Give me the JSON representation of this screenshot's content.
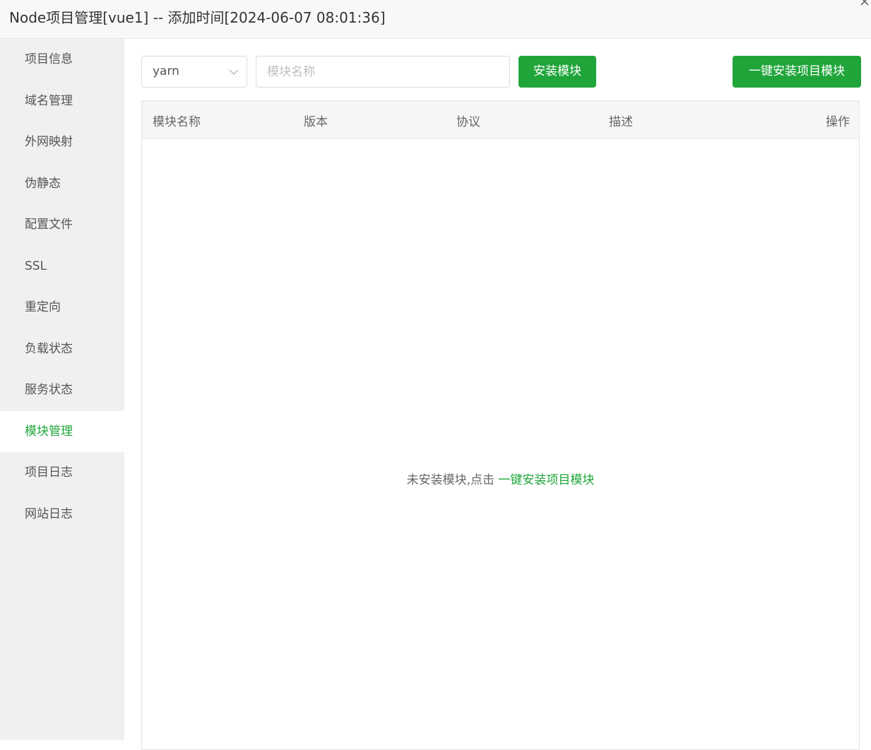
{
  "header": {
    "title": "Node项目管理[vue1] -- 添加时间[2024-06-07 08:01:36]"
  },
  "sidebar": {
    "items": [
      {
        "label": "项目信息"
      },
      {
        "label": "域名管理"
      },
      {
        "label": "外网映射"
      },
      {
        "label": "伪静态"
      },
      {
        "label": "配置文件"
      },
      {
        "label": "SSL"
      },
      {
        "label": "重定向"
      },
      {
        "label": "负载状态"
      },
      {
        "label": "服务状态"
      },
      {
        "label": "模块管理"
      },
      {
        "label": "项目日志"
      },
      {
        "label": "网站日志"
      }
    ],
    "active_index": 9
  },
  "toolbar": {
    "package_manager": "yarn",
    "module_placeholder": "模块名称",
    "install_label": "安装模块",
    "one_click_label": "一键安装项目模块"
  },
  "table": {
    "columns": [
      "模块名称",
      "版本",
      "协议",
      "描述",
      "操作"
    ],
    "rows": [],
    "empty_text": "未安装模块,点击 ",
    "empty_link": "一键安装项目模块"
  },
  "colors": {
    "accent": "#20a53a",
    "sidebar_bg": "#f0f0f0",
    "header_bg": "#f8f8f8"
  },
  "icons": {
    "select_chevron": "chevron-down-icon",
    "window_corner": "close-icon"
  }
}
